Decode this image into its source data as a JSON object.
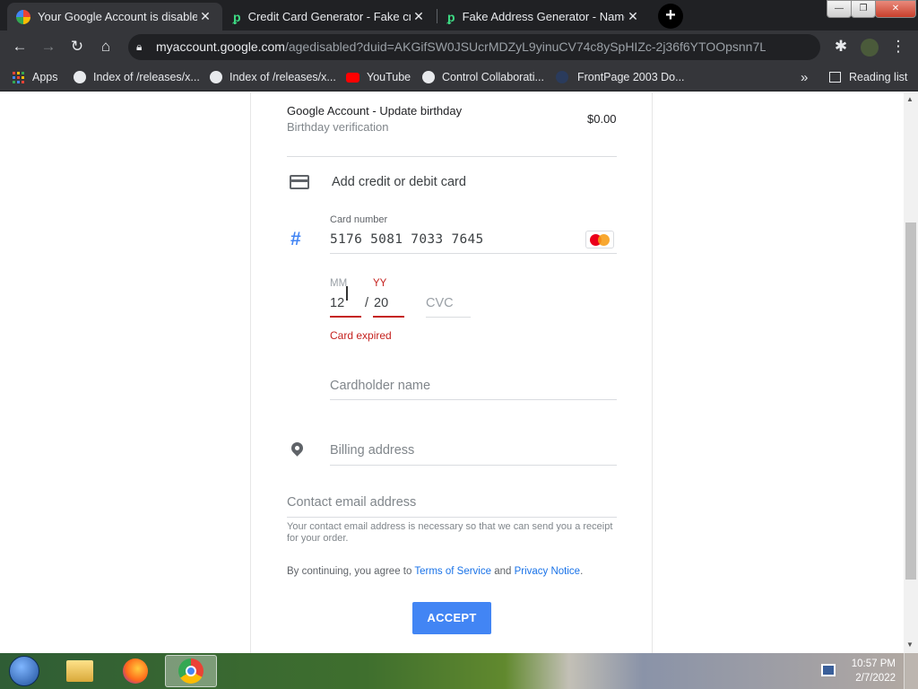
{
  "browser": {
    "tabs": [
      {
        "title": "Your Google Account is disabled",
        "close": "✕"
      },
      {
        "title": "Credit Card Generator - Fake cre",
        "close": "✕"
      },
      {
        "title": "Fake Address Generator - Name,",
        "close": "✕"
      }
    ],
    "new_tab": "+",
    "window_controls": {
      "minimize": "—",
      "maximize": "❐",
      "close": "✕"
    },
    "url_host": "myaccount.google.com",
    "url_path": "/agedisabled?duid=AKGifSW0JSUcrMDZyL9yinuCV74c8ySpHIZc-2j36f6YTOOpsnn7L...",
    "bookmarks": [
      {
        "label": "Apps",
        "icon": "apps-grid-icon"
      },
      {
        "label": "Index of /releases/x...",
        "icon": "globe-icon"
      },
      {
        "label": "Index of /releases/x...",
        "icon": "globe-icon"
      },
      {
        "label": "YouTube",
        "icon": "youtube-icon"
      },
      {
        "label": "Control Collaborati...",
        "icon": "globe-icon"
      },
      {
        "label": "FrontPage 2003 Do...",
        "icon": "frontpage-icon"
      }
    ],
    "bookmarks_overflow": "»",
    "reading_list": "Reading list"
  },
  "purchase": {
    "item_title": "Google Account - Update birthday",
    "item_subtitle": "Birthday verification",
    "price": "$0.00"
  },
  "payment": {
    "add_card_label": "Add credit or debit card",
    "card_number_label": "Card number",
    "card_number_value": "5176 5081 7033 7645",
    "card_brand": "mastercard",
    "mm_label": "MM",
    "yy_label": "YY",
    "mm_value": "12",
    "date_separator": "/",
    "yy_value": "20",
    "cvc_placeholder": "CVC",
    "error": "Card expired",
    "cardholder_placeholder": "Cardholder name",
    "billing_placeholder": "Billing address",
    "contact_placeholder": "Contact email address",
    "contact_help": "Your contact email address is necessary so that we can send you a receipt for your order.",
    "terms_prefix": "By continuing, you agree to ",
    "terms_link": "Terms of Service",
    "terms_and": " and ",
    "privacy_link": "Privacy Notice",
    "terms_suffix": ".",
    "accept_button": "ACCEPT"
  },
  "taskbar": {
    "time": "10:57 PM",
    "date": "2/7/2022"
  },
  "colors": {
    "accent": "#4285f4",
    "error": "#c5221f",
    "link": "#1a73e8",
    "chrome_dark": "#35363a"
  }
}
